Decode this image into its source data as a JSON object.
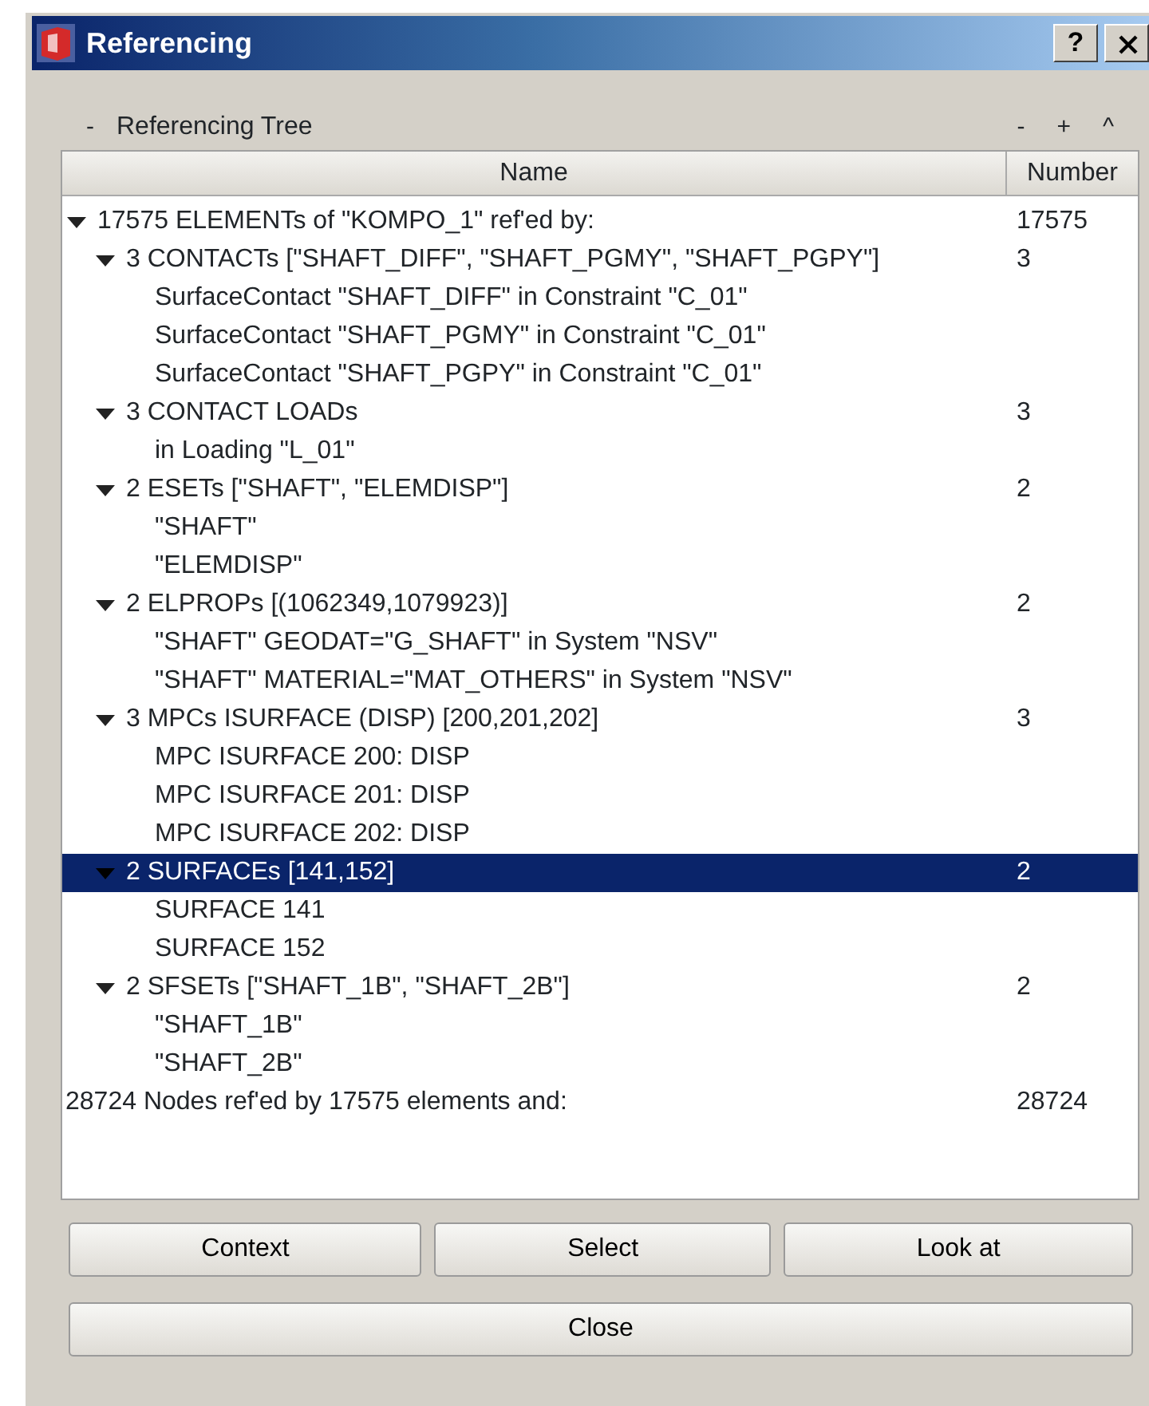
{
  "window": {
    "title": "Referencing"
  },
  "title_buttons": [
    {
      "kind": "help",
      "label": "?"
    },
    {
      "kind": "close"
    }
  ],
  "panel": {
    "collapse": "-",
    "title": "Referencing Tree",
    "controls": [
      "-",
      "+",
      "^"
    ]
  },
  "table": {
    "columns": [
      "Name",
      "Number"
    ],
    "rows": [
      {
        "label": "17575 ELEMENTs of \"KOMPO_1\" ref'ed by:",
        "number": "17575",
        "expanded": true,
        "selected": false,
        "children": [
          {
            "label": "3 CONTACTs [\"SHAFT_DIFF\", \"SHAFT_PGMY\", \"SHAFT_PGPY\"]",
            "number": "3",
            "expanded": true,
            "selected": false,
            "children": [
              {
                "label": "SurfaceContact \"SHAFT_DIFF\" in Constraint \"C_01\"",
                "selected": false
              },
              {
                "label": "SurfaceContact \"SHAFT_PGMY\" in Constraint \"C_01\"",
                "selected": false
              },
              {
                "label": "SurfaceContact \"SHAFT_PGPY\" in Constraint \"C_01\"",
                "selected": false
              }
            ]
          },
          {
            "label": "3 CONTACT LOADs",
            "number": "3",
            "expanded": true,
            "selected": false,
            "children": [
              {
                "label": "in Loading \"L_01\"",
                "selected": false
              }
            ]
          },
          {
            "label": "2 ESETs [\"SHAFT\", \"ELEMDISP\"]",
            "number": "2",
            "expanded": true,
            "selected": false,
            "children": [
              {
                "label": "\"SHAFT\"",
                "selected": false
              },
              {
                "label": "\"ELEMDISP\"",
                "selected": false
              }
            ]
          },
          {
            "label": "2 ELPROPs [(1062349,1079923)]",
            "number": "2",
            "expanded": true,
            "selected": false,
            "children": [
              {
                "label": "\"SHAFT\" GEODAT=\"G_SHAFT\" in System \"NSV\"",
                "selected": false
              },
              {
                "label": "\"SHAFT\" MATERIAL=\"MAT_OTHERS\" in System \"NSV\"",
                "selected": false
              }
            ]
          },
          {
            "label": "3 MPCs ISURFACE (DISP) [200,201,202]",
            "number": "3",
            "expanded": true,
            "selected": false,
            "children": [
              {
                "label": "MPC ISURFACE 200: DISP",
                "selected": false
              },
              {
                "label": "MPC ISURFACE 201: DISP",
                "selected": false
              },
              {
                "label": "MPC ISURFACE 202: DISP",
                "selected": false
              }
            ]
          },
          {
            "label": "2 SURFACEs [141,152]",
            "number": "2",
            "expanded": true,
            "selected": true,
            "children": [
              {
                "label": "SURFACE 141",
                "selected": false
              },
              {
                "label": "SURFACE 152",
                "selected": false
              }
            ]
          },
          {
            "label": "2 SFSETs [\"SHAFT_1B\", \"SHAFT_2B\"]",
            "number": "2",
            "expanded": true,
            "selected": false,
            "children": [
              {
                "label": "\"SHAFT_1B\"",
                "selected": false
              },
              {
                "label": "\"SHAFT_2B\"",
                "selected": false
              }
            ]
          }
        ]
      },
      {
        "label": "28724 Nodes ref'ed by 17575 elements and:",
        "number": "28724",
        "selected": false
      }
    ]
  },
  "buttons": [
    "Context",
    "Select",
    "Look at"
  ],
  "close_button": "Close"
}
